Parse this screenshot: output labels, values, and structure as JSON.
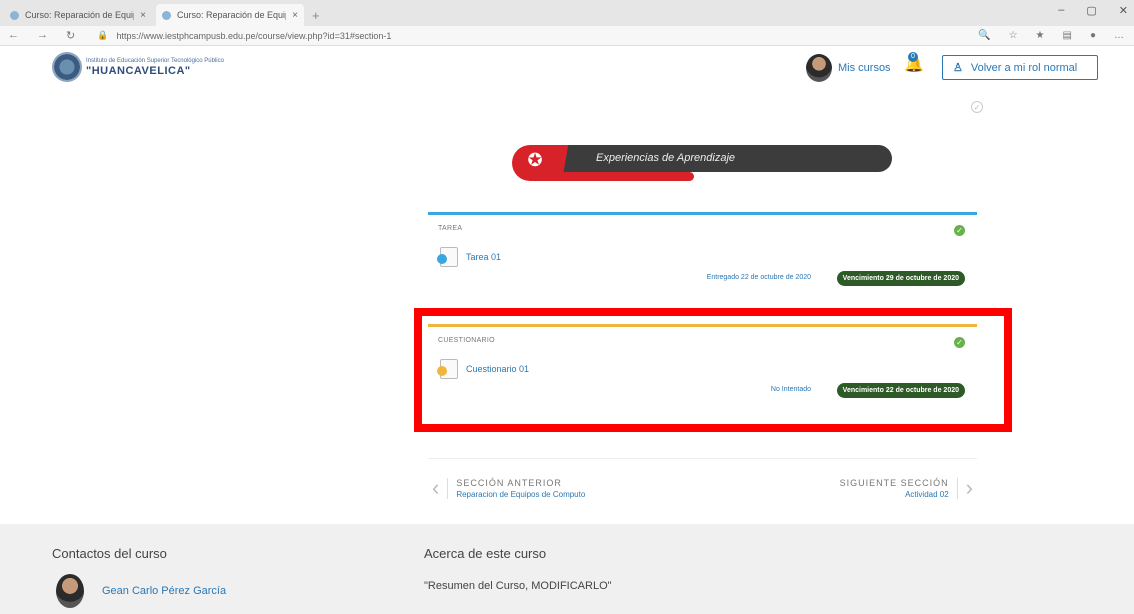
{
  "browser": {
    "tabs": [
      {
        "label": "Curso: Reparación de Equipos de..."
      },
      {
        "label": "Curso: Reparación de Equipos de..."
      }
    ],
    "new_tab": "+",
    "url": "https://www.iestphcampusb.edu.pe/course/view.php?id=31#section-1"
  },
  "site": {
    "logo_small": "Instituto de Educación Superior Tecnológico Público",
    "logo_big": "\"HUANCAVELICA\"",
    "mis_cursos": "Mis cursos",
    "notification_count": "0",
    "rol_button": "Volver a mi rol normal"
  },
  "banner": {
    "title": "Experiencias de Aprendizaje"
  },
  "activities": [
    {
      "type": "TAREA",
      "name": "Tarea 01",
      "status": "Entregado 22 de octubre de 2020",
      "due": "Vencimiento 29 de octubre de 2020",
      "dot_color": "#3aa6e0"
    },
    {
      "type": "CUESTIONARIO",
      "name": "Cuestionario 01",
      "status": "No Intentado",
      "due": "Vencimiento 22 de octubre de 2020",
      "dot_color": "#f1b53b"
    }
  ],
  "section_nav": {
    "prev_label": "SECCIÓN ANTERIOR",
    "prev_name": "Reparacion de Equipos de Computo",
    "next_label": "SIGUIENTE SECCIÓN",
    "next_name": "Actividad 02"
  },
  "footer": {
    "contacts_heading": "Contactos del curso",
    "contact_name": "Gean Carlo Pérez García",
    "about_heading": "Acerca de este curso",
    "summary": "\"Resumen del Curso, MODIFICARLO\""
  },
  "colors": {
    "accent": "#2a78b5",
    "highlight": "#ff0000",
    "due_badge": "#2d5a26",
    "banner_red": "#d8222a"
  }
}
